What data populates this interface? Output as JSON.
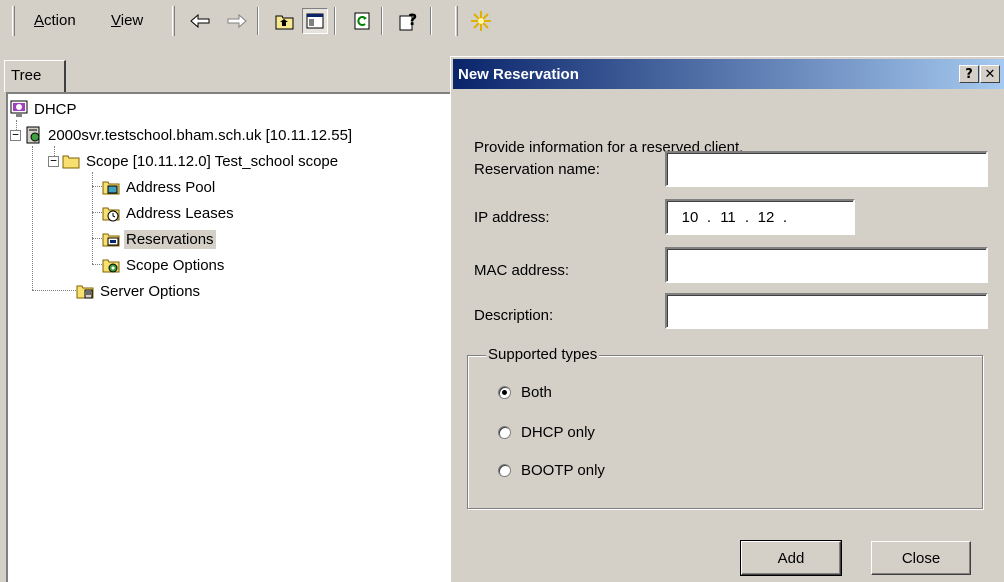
{
  "toolbar": {
    "menu": [
      {
        "label": "Action",
        "accel": "A",
        "rest": "ction"
      },
      {
        "label": "View",
        "accel": "V",
        "rest": "iew"
      }
    ],
    "buttons": [
      "back-arrow-icon",
      "forward-arrow-icon",
      "up-one-level-icon",
      "show-hide-console-tree-icon",
      "refresh-icon",
      "help-icon",
      "new-icon"
    ]
  },
  "tree": {
    "tab_label": "Tree",
    "items": [
      {
        "label": "DHCP",
        "icon": "dhcp-root-icon"
      },
      {
        "label": "2000svr.testschool.bham.sch.uk [10.11.12.55]",
        "icon": "dhcp-server-icon",
        "expander": "−"
      },
      {
        "label": "Scope [10.11.12.0] Test_school scope",
        "icon": "folder-icon",
        "expander": "−"
      },
      {
        "label": "Address Pool",
        "icon": "address-pool-icon"
      },
      {
        "label": "Address Leases",
        "icon": "address-leases-icon"
      },
      {
        "label": "Reservations",
        "icon": "reservations-icon",
        "selected": true
      },
      {
        "label": "Scope Options",
        "icon": "scope-options-icon"
      },
      {
        "label": "Server Options",
        "icon": "server-options-icon"
      }
    ]
  },
  "dialog": {
    "title": "New Reservation",
    "help_button": "?",
    "close_button": "✕",
    "prompt": "Provide information for a reserved client.",
    "fields": {
      "reservation_name": {
        "label": "Reservation name:",
        "value": ""
      },
      "ip_address": {
        "label": "IP address:",
        "octets": [
          "10",
          "11",
          "12",
          ""
        ]
      },
      "mac_address": {
        "label": "MAC address:",
        "value": ""
      },
      "description": {
        "label": "Description:",
        "value": ""
      }
    },
    "supported_types": {
      "title": "Supported types",
      "options": [
        {
          "label": "Both",
          "checked": true
        },
        {
          "label": "DHCP only",
          "checked": false
        },
        {
          "label": "BOOTP only",
          "checked": false
        }
      ]
    },
    "add_button": "Add",
    "close_label": "Close"
  },
  "colors": {
    "face": "#d4d0c8",
    "title_start": "#0a246a",
    "title_end": "#a6caf0"
  }
}
